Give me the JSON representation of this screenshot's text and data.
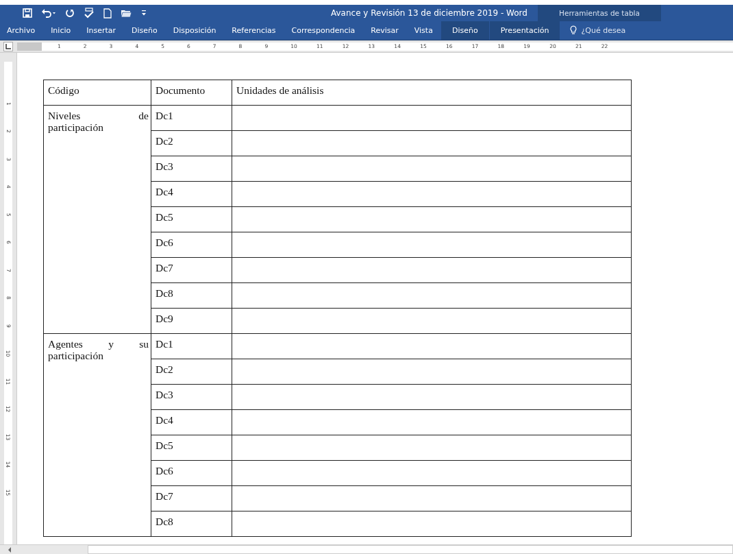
{
  "window": {
    "title": "Avance y Revisión 13 de diciembre 2019 - Word",
    "context_title": "Herramientas de tabla"
  },
  "tabs": [
    {
      "label": "Archivo",
      "kind": "normal",
      "selected": false
    },
    {
      "label": "Inicio",
      "kind": "normal",
      "selected": false
    },
    {
      "label": "Insertar",
      "kind": "normal",
      "selected": false
    },
    {
      "label": "Diseño",
      "kind": "normal",
      "selected": false
    },
    {
      "label": "Disposición",
      "kind": "normal",
      "selected": false
    },
    {
      "label": "Referencias",
      "kind": "normal",
      "selected": false
    },
    {
      "label": "Correspondencia",
      "kind": "normal",
      "selected": false
    },
    {
      "label": "Revisar",
      "kind": "normal",
      "selected": false
    },
    {
      "label": "Vista",
      "kind": "normal",
      "selected": false
    },
    {
      "label": "Diseño",
      "kind": "context",
      "selected": false
    },
    {
      "label": "Presentación",
      "kind": "context",
      "selected": false
    }
  ],
  "tell_me": {
    "placeholder": "¿Qué desea"
  },
  "ruler": {
    "numbers": [
      "1",
      "2",
      "3",
      "4",
      "5",
      "6",
      "7",
      "8",
      "9",
      "10",
      "11",
      "12",
      "13",
      "14",
      "15",
      "16",
      "17",
      "18",
      "19",
      "20",
      "21",
      "22"
    ]
  },
  "vertical_ruler": {
    "numbers": [
      "1",
      "2",
      "3",
      "4",
      "5",
      "6",
      "7",
      "8",
      "9",
      "10",
      "11",
      "12",
      "13",
      "14",
      "15"
    ]
  },
  "table": {
    "columns": [
      "Código",
      "Documento",
      "Unidades de análisis"
    ],
    "groups": [
      {
        "label": "Niveles de participación",
        "rows": [
          "Dc1",
          "Dc2",
          "Dc3",
          "Dc4",
          "Dc5",
          "Dc6",
          "Dc7",
          "Dc8",
          "Dc9"
        ]
      },
      {
        "label": "Agentes y su participación",
        "rows": [
          "Dc1",
          "Dc2",
          "Dc3",
          "Dc4",
          "Dc5",
          "Dc6",
          "Dc7",
          "Dc8"
        ]
      }
    ]
  }
}
